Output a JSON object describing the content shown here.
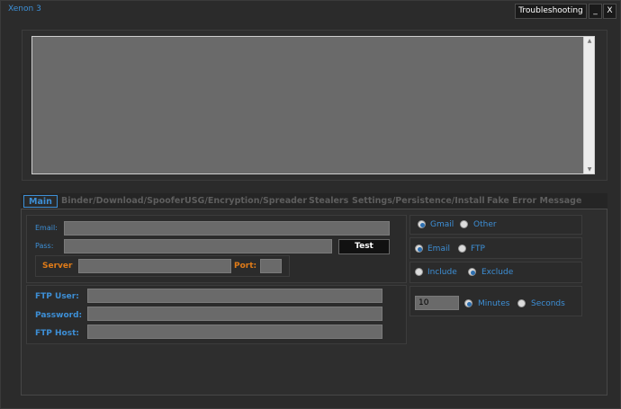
{
  "window": {
    "title": "Xenon 3",
    "troubleshooting_label": "Troubleshooting",
    "minimize_label": "_",
    "close_label": "X"
  },
  "tabs": [
    {
      "label": "Main"
    },
    {
      "label": "Binder/Download/Spoofer"
    },
    {
      "label": "USG/Encryption/Spreader"
    },
    {
      "label": "Stealers"
    },
    {
      "label": "Settings/Persistence/Install"
    },
    {
      "label": "Fake Error Message"
    }
  ],
  "main": {
    "email_label": "Email:",
    "pass_label": "Pass:",
    "test_label": "Test",
    "server_label": "Server",
    "port_label": "Port:",
    "ftp_user_label": "FTP User:",
    "password_label": "Password:",
    "ftp_host_label": "FTP Host:"
  },
  "options": {
    "provider": [
      {
        "label": "Gmail",
        "selected": true
      },
      {
        "label": "Other",
        "selected": false
      }
    ],
    "method": [
      {
        "label": "Email",
        "selected": true
      },
      {
        "label": "FTP",
        "selected": false
      }
    ],
    "mode": [
      {
        "label": "Include",
        "selected": false
      },
      {
        "label": "Exclude",
        "selected": true
      }
    ],
    "interval_value": "10",
    "unit": [
      {
        "label": "Minutes",
        "selected": true
      },
      {
        "label": "Seconds",
        "selected": false
      }
    ]
  },
  "colors": {
    "accent": "#3d8fd6",
    "orange": "#e07b18",
    "field": "#6a6a6a"
  }
}
